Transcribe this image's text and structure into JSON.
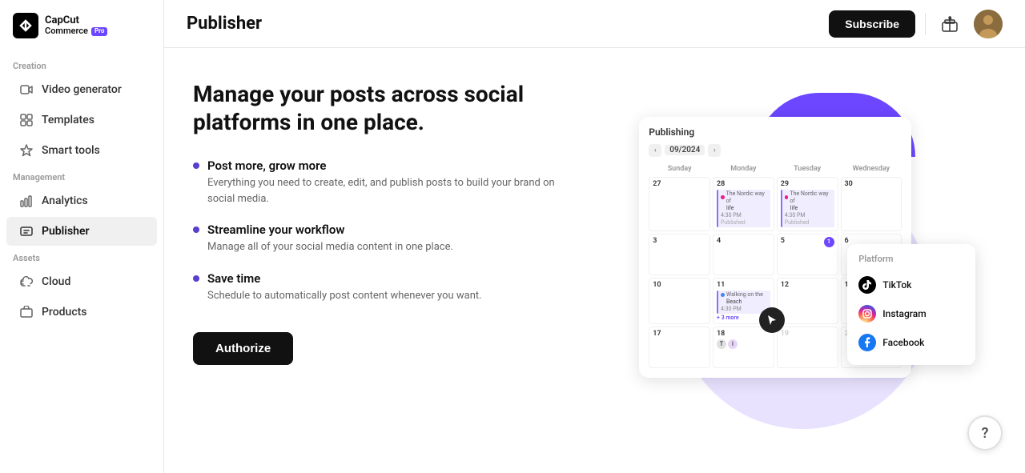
{
  "app": {
    "logo_capcut": "CapCut",
    "logo_commerce": "Commerce",
    "pro_badge": "Pro"
  },
  "sidebar": {
    "creation_label": "Creation",
    "management_label": "Management",
    "assets_label": "Assets",
    "items": [
      {
        "id": "video-generator",
        "label": "Video generator",
        "icon": "video-icon",
        "active": false
      },
      {
        "id": "templates",
        "label": "Templates",
        "icon": "templates-icon",
        "active": false
      },
      {
        "id": "smart-tools",
        "label": "Smart tools",
        "icon": "smart-tools-icon",
        "active": false
      },
      {
        "id": "analytics",
        "label": "Analytics",
        "icon": "analytics-icon",
        "active": false
      },
      {
        "id": "publisher",
        "label": "Publisher",
        "icon": "publisher-icon",
        "active": true
      },
      {
        "id": "cloud",
        "label": "Cloud",
        "icon": "cloud-icon",
        "active": false
      },
      {
        "id": "products",
        "label": "Products",
        "icon": "products-icon",
        "active": false
      }
    ]
  },
  "topbar": {
    "page_title": "Publisher",
    "subscribe_label": "Subscribe"
  },
  "main": {
    "hero_title": "Manage your posts across social platforms in one place.",
    "features": [
      {
        "title": "Post more, grow more",
        "desc": "Everything you need to create, edit, and publish posts to build your brand on social media."
      },
      {
        "title": "Streamline your workflow",
        "desc": "Manage all of your social media content in one place."
      },
      {
        "title": "Save time",
        "desc": "Schedule to automatically post content whenever you want."
      }
    ],
    "authorize_label": "Authorize"
  },
  "illustration": {
    "calendar_title": "Publishing",
    "calendar_month": "09/2024",
    "days": [
      "Sunday",
      "Monday",
      "Tuesday",
      "Wednesday"
    ],
    "platform_title": "Platform",
    "platforms": [
      {
        "name": "TikTok",
        "icon": "tiktok"
      },
      {
        "name": "Instagram",
        "icon": "instagram"
      },
      {
        "name": "Facebook",
        "icon": "facebook"
      }
    ]
  },
  "help": {
    "icon": "?"
  }
}
